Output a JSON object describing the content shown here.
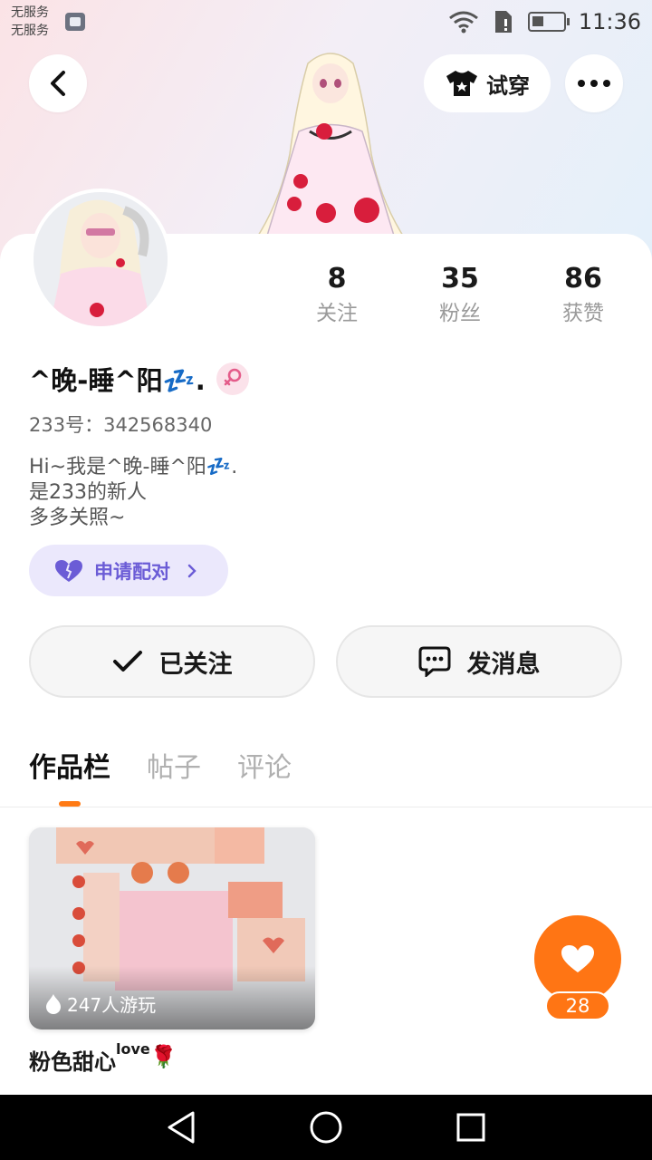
{
  "status_bar": {
    "carrier_line1": "无服务",
    "carrier_line2": "无服务",
    "time": "11:36"
  },
  "header": {
    "try_on_label": "试穿",
    "icons": [
      "back-arrow-icon",
      "tshirt-icon",
      "more-dots-icon"
    ]
  },
  "profile": {
    "nickname": "^晚-睡^阳💤.",
    "gender_symbol": "♀",
    "uid_line": "233号：342568340",
    "bio": [
      "Hi~我是^晚-睡^阳💤.",
      "是233的新人",
      "多多关照~"
    ],
    "stats": [
      {
        "value": "8",
        "label": "关注"
      },
      {
        "value": "35",
        "label": "粉丝"
      },
      {
        "value": "86",
        "label": "获赞"
      }
    ],
    "pair_button": "申请配对"
  },
  "actions": {
    "follow_label": "已关注",
    "message_label": "发消息"
  },
  "tabs": [
    {
      "label": "作品栏",
      "active": true
    },
    {
      "label": "帖子",
      "active": false
    },
    {
      "label": "评论",
      "active": false
    }
  ],
  "works": [
    {
      "title": "粉色甜心",
      "title_sup": "love",
      "title_suffix": "🌹",
      "plays": "247人游玩"
    }
  ],
  "like_fab": {
    "count": "28"
  },
  "colors": {
    "accent": "#ff7514",
    "pair_text": "#6b5cd6",
    "pair_bg": "#ebe8fc"
  }
}
